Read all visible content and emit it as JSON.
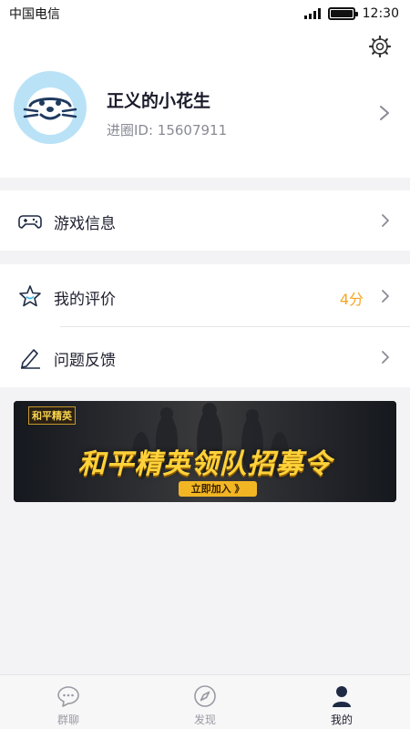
{
  "status_bar": {
    "carrier": "中国电信",
    "time": "12:30",
    "signal_icon": "signal-icon",
    "battery_icon": "battery-icon",
    "battery_level": 1.0
  },
  "profile": {
    "settings_icon": "gear-icon",
    "avatar_icon": "seal-avatar",
    "nickname": "正义的小花生",
    "circle_id": "进圈ID: 15607911"
  },
  "menu": {
    "game_info": {
      "icon": "gamepad-icon",
      "label": "游戏信息"
    },
    "my_rating": {
      "icon": "star-icon",
      "label": "我的评价",
      "value": "4分"
    },
    "feedback": {
      "icon": "pencil-icon",
      "label": "问题反馈"
    }
  },
  "banner": {
    "logo_text": "和平精英",
    "title": "和平精英领队招募令",
    "button_label": "立即加入 》"
  },
  "tabbar": {
    "tabs": [
      {
        "icon": "chat-bubble-icon",
        "label": "群聊"
      },
      {
        "icon": "compass-icon",
        "label": "发现"
      },
      {
        "icon": "person-icon",
        "label": "我的"
      }
    ]
  },
  "colors": {
    "accent_value": "#f5a623",
    "active_tab": "#1f1f2e",
    "inactive_tab": "#9a9aa3"
  }
}
